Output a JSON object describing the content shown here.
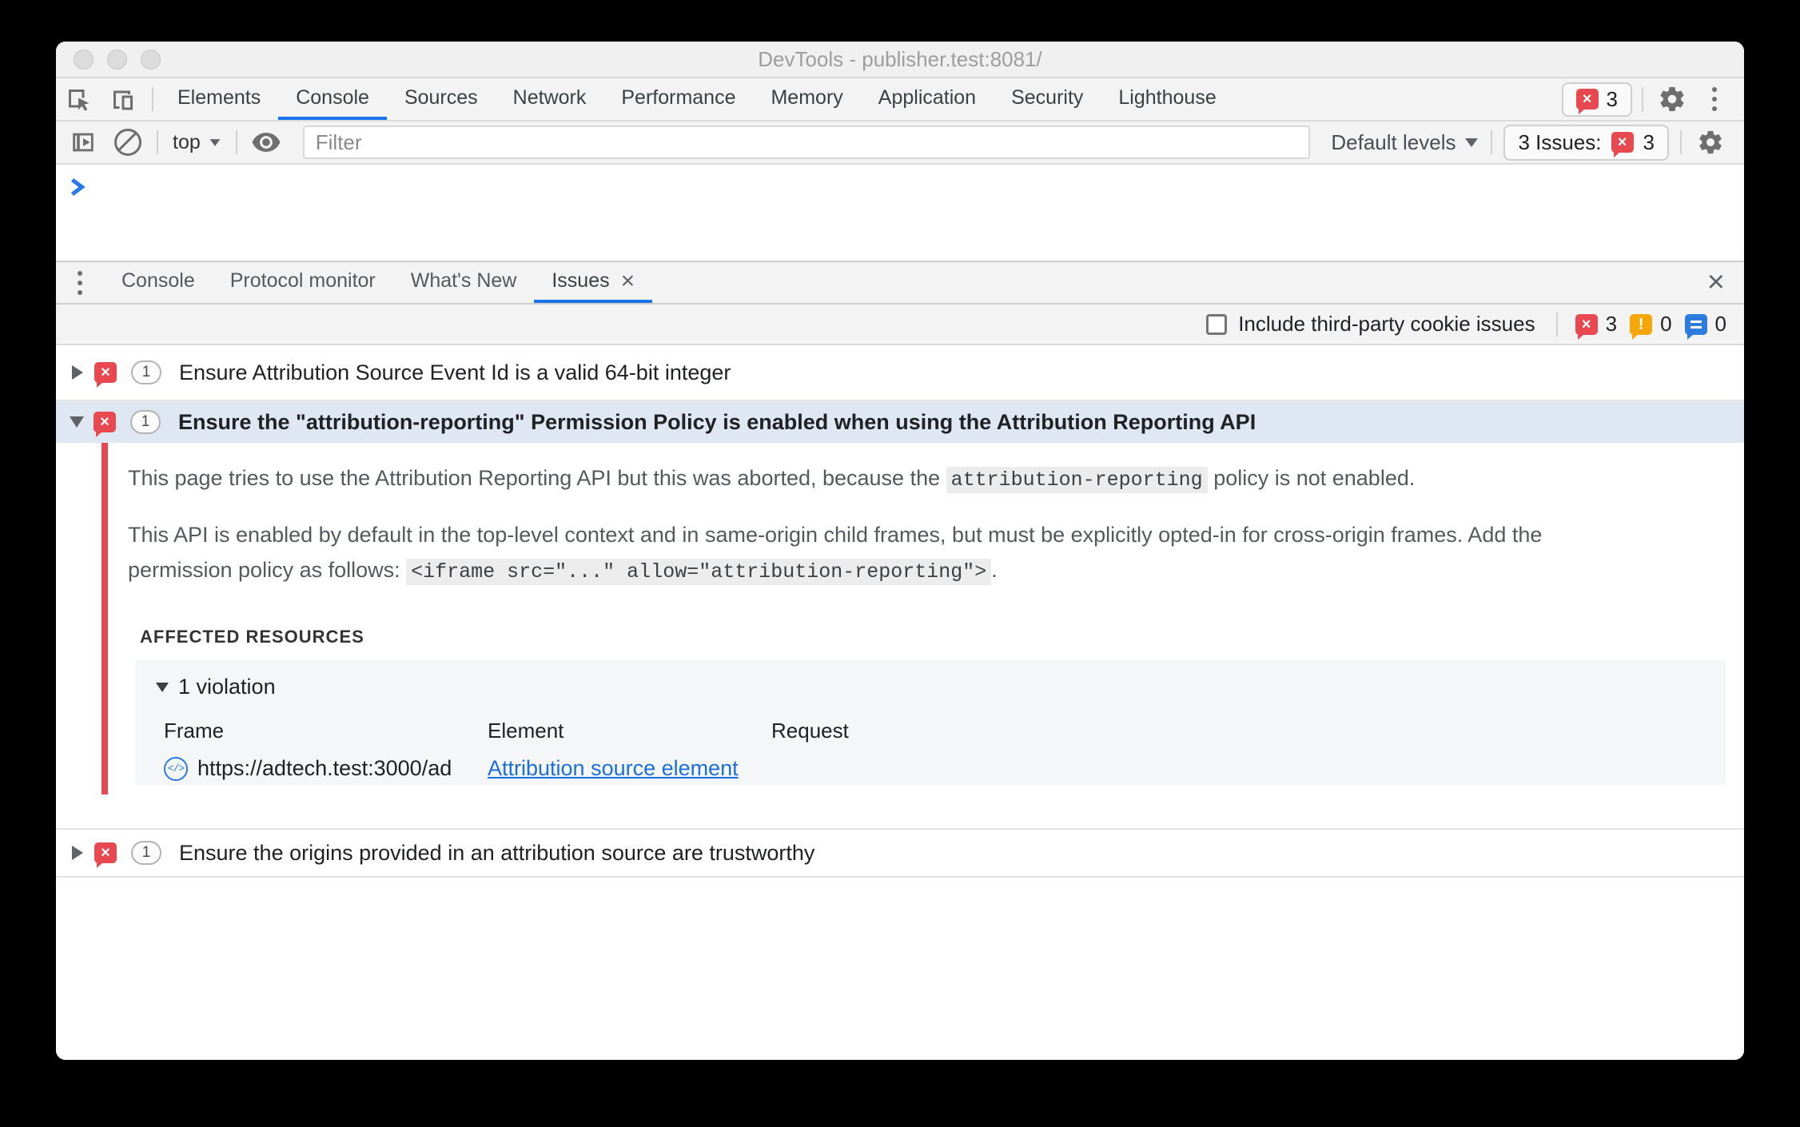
{
  "window": {
    "title": "DevTools - publisher.test:8081/"
  },
  "main_tabs": {
    "items": [
      "Elements",
      "Console",
      "Sources",
      "Network",
      "Performance",
      "Memory",
      "Application",
      "Security",
      "Lighthouse"
    ],
    "selected": "Console",
    "error_badge_count": "3"
  },
  "console_toolbar": {
    "context_selector": "top",
    "filter_placeholder": "Filter",
    "levels_label": "Default levels",
    "issues_button_text": "3 Issues:",
    "issues_button_count": "3"
  },
  "drawer": {
    "tabs": [
      "Console",
      "Protocol monitor",
      "What's New",
      "Issues"
    ],
    "selected": "Issues",
    "tab_close": "×",
    "panel_close": "×"
  },
  "issues_toolbar": {
    "checkbox_label": "Include third-party cookie issues",
    "error_count": "3",
    "warning_count": "0",
    "info_count": "0"
  },
  "issues": {
    "rows": [
      {
        "count": "1",
        "title": "Ensure Attribution Source Event Id is a valid 64-bit integer"
      },
      {
        "count": "1",
        "title": "Ensure the \"attribution-reporting\" Permission Policy is enabled when using the Attribution Reporting API"
      },
      {
        "count": "1",
        "title": "Ensure the origins provided in an attribution source are trustworthy"
      }
    ],
    "detail": {
      "para1_before": "This page tries to use the Attribution Reporting API but this was aborted, because the ",
      "para1_code": "attribution-reporting",
      "para1_after": " policy is not enabled.",
      "para2_before": "This API is enabled by default in the top-level context and in same-origin child frames, but must be explicitly opted-in for cross-origin frames. Add the permission policy as follows: ",
      "para2_code": "<iframe src=\"...\" allow=\"attribution-reporting\">",
      "para2_after": ".",
      "affected_heading": "AFFECTED RESOURCES",
      "violation_label": "1 violation",
      "table_headers": [
        "Frame",
        "Element",
        "Request"
      ],
      "frame_icon_glyph": "</>",
      "frame_url": "https://adtech.test:3000/ad",
      "element_link": "Attribution source element"
    }
  },
  "icons": {
    "error": "×",
    "warning": "!"
  },
  "colors": {
    "accent_blue": "#1a73e8",
    "error_red": "#e8484f",
    "warning_orange": "#f5a70a",
    "info_blue": "#2f7ce0",
    "selected_row_bg": "#dfe7f3",
    "link_blue": "#1b6ede"
  }
}
